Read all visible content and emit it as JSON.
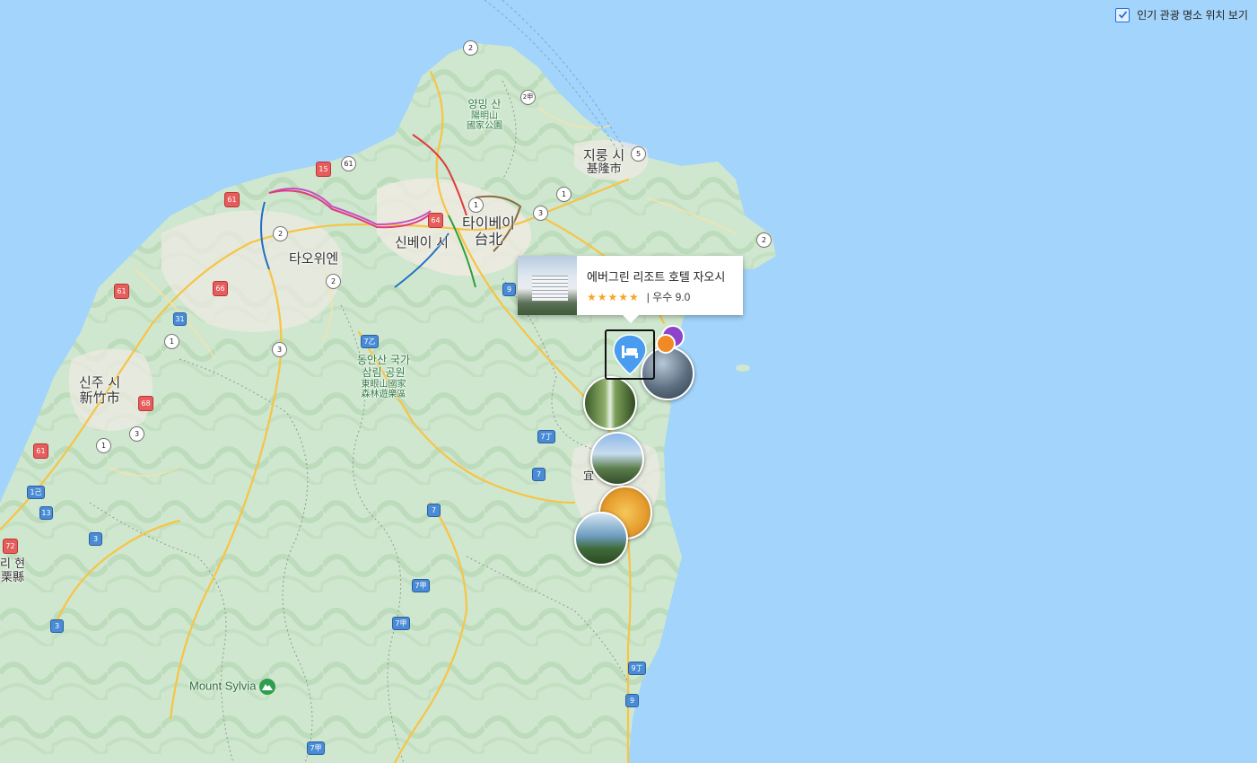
{
  "toggle": {
    "label": "인기 관광 명소 위치 보기",
    "checked": true,
    "icon": "checkbox-checked-icon"
  },
  "place_labels": [
    {
      "id": "yangmingshan",
      "kr": "양밍 산",
      "cn": "陽明山\n國家公園",
      "kind": "park"
    },
    {
      "id": "keelung",
      "kr": "지룽 시",
      "cn": "基隆市",
      "kind": "city"
    },
    {
      "id": "taipei",
      "kr": "타이베이",
      "cn": "台北",
      "kind": "city"
    },
    {
      "id": "newtaipei",
      "kr": "신베이 시",
      "cn": "",
      "kind": "city"
    },
    {
      "id": "taoyuan",
      "kr": "타오위엔",
      "cn": "",
      "kind": "city"
    },
    {
      "id": "dongyanshan",
      "kr": "동안산 국가\n삼림 공원",
      "cn": "東眼山國家\n森林遊樂區",
      "kind": "park"
    },
    {
      "id": "hsinchu",
      "kr": "신주 시",
      "cn": "新竹市",
      "kind": "city"
    },
    {
      "id": "miaoli",
      "kr": "리 현",
      "cn": "栗縣",
      "kind": "city"
    },
    {
      "id": "yilan",
      "kr": "",
      "cn": "宜",
      "kind": "city"
    }
  ],
  "mountain": {
    "label": "Mount Sylvia",
    "icon": "mountain-peak-icon"
  },
  "road_shields": [
    "2",
    "2甲",
    "1",
    "3",
    "5",
    "2",
    "61",
    "15",
    "61",
    "64",
    "1",
    "2",
    "2",
    "61",
    "66",
    "31",
    "1",
    "3",
    "9",
    "7乙",
    "68",
    "1",
    "3",
    "61",
    "1己",
    "13",
    "3",
    "72",
    "3",
    "7",
    "7丁",
    "7",
    "7甲",
    "7甲",
    "9丁",
    "9",
    "7甲"
  ],
  "hotel_card": {
    "name": "에버그린 리조트 호텔 자오시",
    "stars": "★★★★★",
    "rating_text": "| 우수 9.0",
    "icon": "hotel-bed-icon"
  },
  "colors": {
    "water": "#a3d4fb",
    "land": "#d9ecd9",
    "urban": "#eeeae2",
    "major_road": "#f7c445",
    "pin": "#4a9cf0"
  }
}
